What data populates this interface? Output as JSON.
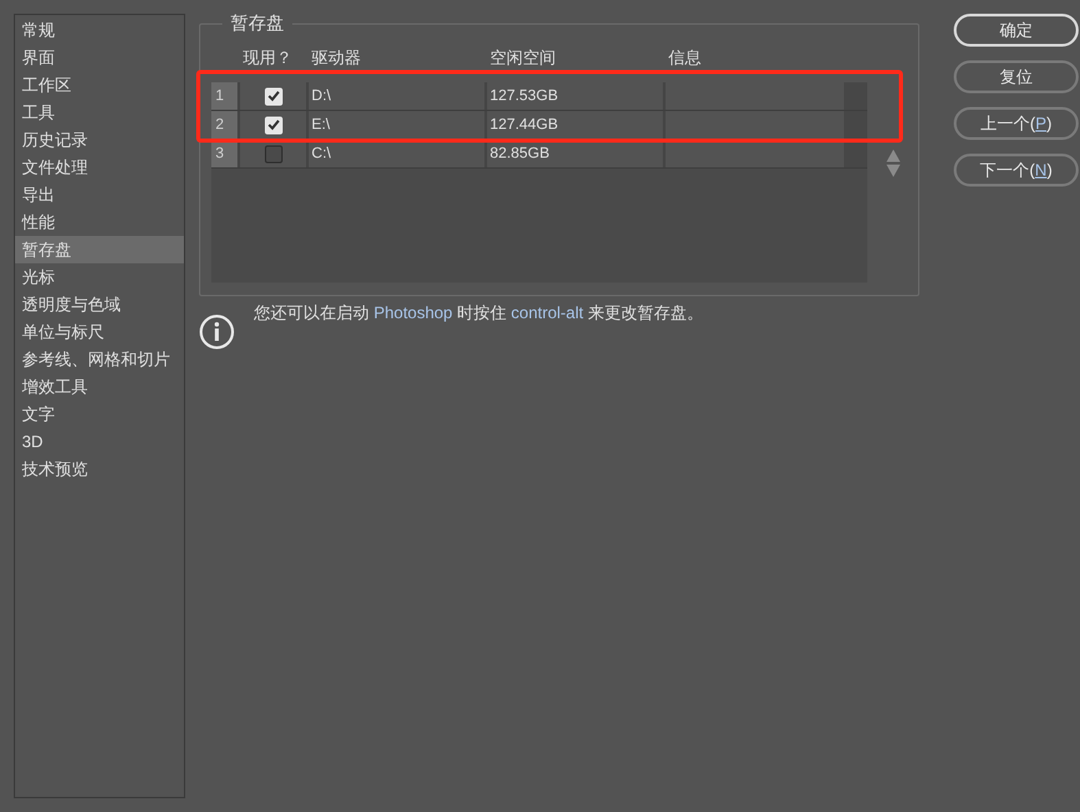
{
  "sidebar": {
    "items": [
      {
        "label": "常规",
        "selected": false
      },
      {
        "label": "界面",
        "selected": false
      },
      {
        "label": "工作区",
        "selected": false
      },
      {
        "label": "工具",
        "selected": false
      },
      {
        "label": "历史记录",
        "selected": false
      },
      {
        "label": "文件处理",
        "selected": false
      },
      {
        "label": "导出",
        "selected": false
      },
      {
        "label": "性能",
        "selected": false
      },
      {
        "label": "暂存盘",
        "selected": true
      },
      {
        "label": "光标",
        "selected": false
      },
      {
        "label": "透明度与色域",
        "selected": false
      },
      {
        "label": "单位与标尺",
        "selected": false
      },
      {
        "label": "参考线、网格和切片",
        "selected": false
      },
      {
        "label": "增效工具",
        "selected": false
      },
      {
        "label": "文字",
        "selected": false
      },
      {
        "label": "3D",
        "selected": false
      },
      {
        "label": "技术预览",
        "selected": false
      }
    ]
  },
  "group": {
    "title": "暂存盘",
    "columns": [
      "现用？",
      "驱动器",
      "空闲空间",
      "信息"
    ],
    "rows": [
      {
        "index": "1",
        "checked": true,
        "drive": "D:\\",
        "free": "127.53GB"
      },
      {
        "index": "2",
        "checked": true,
        "drive": "E:\\",
        "free": "127.44GB"
      },
      {
        "index": "3",
        "checked": false,
        "drive": "C:\\",
        "free": "82.85GB"
      }
    ]
  },
  "info": [
    {
      "text": "您还可以在启动 ",
      "highlight": false
    },
    {
      "text": "Photoshop",
      "highlight": true
    },
    {
      "text": " 时按住 ",
      "highlight": false
    },
    {
      "text": "control-alt",
      "highlight": true
    },
    {
      "text": " 来更改暂存盘。",
      "highlight": false
    }
  ],
  "buttons": [
    {
      "label": "确定",
      "kind": "default"
    },
    {
      "label": "复位",
      "kind": "normal"
    },
    {
      "label": "上一个(",
      "key": "P",
      "suffix": ")",
      "kind": "normal"
    },
    {
      "label": "下一个(",
      "key": "N",
      "suffix": ")",
      "kind": "normal"
    }
  ],
  "annotation": {
    "kind": "highlight-box"
  }
}
